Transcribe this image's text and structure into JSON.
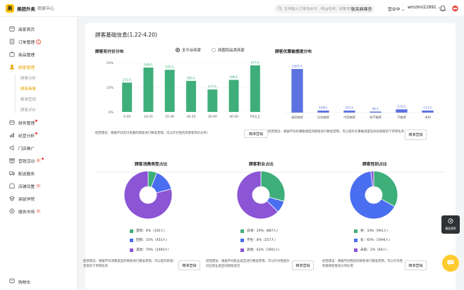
{
  "app": {
    "logo_char": "美",
    "name": "美团外卖",
    "center": "商家中心"
  },
  "search": {
    "placeholder": "支持输入订单流水号、商品名称、顾客地址"
  },
  "shop": {
    "name": "张亮麻辣烫",
    "status": "营业中",
    "account": "wmzlml21891"
  },
  "sidebar": {
    "items": [
      {
        "label": "商家首页",
        "icon": "home-icon"
      },
      {
        "label": "订单管理",
        "icon": "order-icon",
        "badge_count": "1"
      },
      {
        "label": "商品管理",
        "icon": "goods-icon"
      },
      {
        "label": "顾客管理",
        "icon": "customer-icon",
        "active": true
      },
      {
        "label": "财务管理",
        "icon": "finance-icon",
        "dot": true
      },
      {
        "label": "经营分析",
        "icon": "analysis-icon",
        "dot": true
      },
      {
        "label": "门店推广",
        "icon": "promo-icon"
      },
      {
        "label": "营销活动",
        "icon": "activity-icon",
        "badge": "新",
        "dot": true
      },
      {
        "label": "配送服务",
        "icon": "delivery-icon"
      },
      {
        "label": "店铺设置",
        "icon": "shop-settings-icon",
        "badge": "新"
      },
      {
        "label": "袋鼠学院",
        "icon": "school-icon"
      },
      {
        "label": "服务市场",
        "icon": "market-icon",
        "badge": "新"
      }
    ],
    "sub_items": [
      {
        "label": "顾客分析"
      },
      {
        "label": "顾客画像",
        "current": true
      },
      {
        "label": "精准营销"
      },
      {
        "label": "顾客评价"
      }
    ],
    "feedback": "购物车"
  },
  "main": {
    "title": "顾客基础信息(1.22-4.20)",
    "price_section": {
      "title": "顾客实付价分布",
      "options": [
        {
          "label": "全平台商家",
          "selected": true
        },
        {
          "label": "商圈同品类商家",
          "selected": false
        }
      ],
      "tip": "经营建议：根据不同实付金额的顾客进行精准营销，可以针对性的改善客单价分布！",
      "button": "精准营销"
    },
    "sensitivity_section": {
      "title": "顾客优惠敏感度分布",
      "tip": "经营建议：根据不同优惠敏感度的顾客进行精准营销，可以提升优惠敏感度较高的顾客的下单转化率",
      "button": "精准营销"
    },
    "pies": [
      {
        "title": "顾客消费类型占比",
        "legend": [
          "首购：6%（192人）",
          "回购：15%（453人）",
          "其他：79%（2400人）"
        ],
        "tip": "经营建议：根据不同消费类型的顾客进行精准营销，可以提升新客/老客的下单转化率",
        "button": "精准营销"
      },
      {
        "title": "顾客职业占比",
        "legend": [
          "白领：29%（887人）",
          "学生：8%（257人）",
          "其他：62%（1901人）"
        ],
        "tip": "经营建议：根据不同职业类型进行精准营销，可以针对性提升对应职业类型的顾客进店",
        "button": "精准营销"
      },
      {
        "title": "顾客性别占比",
        "legend": [
          "男：33%（991人）",
          "女：65%（1994人）",
          "未知：2%（60人）"
        ],
        "tip": "经营建议：根据不同性别的顾客进行精准营销，可以针对性改善顾客性别分布比例",
        "button": "精准营销"
      }
    ]
  },
  "float_tool": {
    "label": "精准营销"
  },
  "colors": {
    "green": "#3eae7a",
    "blue": "#4a6ef0",
    "purple": "#8b55d6",
    "accent": "#ffc300",
    "sensitivity_bar": "#5b72e0"
  },
  "chart_data": [
    {
      "type": "bar",
      "title": "顾客实付价分布",
      "categories": [
        "0-20",
        "20-25",
        "25-30",
        "30-35",
        "35-40",
        "40-50",
        "50以上"
      ],
      "values": [
        11.9,
        18.0,
        17.1,
        12.6,
        9.1,
        13.0,
        18.9
      ],
      "data_labels": [
        "372人",
        "548人",
        "522人",
        "385人",
        "277人",
        "396人",
        "577人"
      ],
      "yticks": [
        "0%",
        "10%",
        "20%"
      ],
      "ylim": [
        0,
        20
      ],
      "color": "#3eae7a"
    },
    {
      "type": "bar",
      "title": "顾客优惠敏感度分布",
      "categories": [
        "极度敏感",
        "比较敏感",
        "中度敏感",
        "较不敏感",
        "不敏感",
        "未知"
      ],
      "values": [
        2301,
        108,
        107,
        46,
        172,
        111
      ],
      "data_labels": [
        "2301人",
        "108人",
        "107人",
        "46人",
        "172人",
        "111人"
      ],
      "color": "#5b72e0"
    },
    {
      "type": "pie",
      "title": "顾客消费类型占比",
      "labels": [
        "首购",
        "回购",
        "其他"
      ],
      "values": [
        6,
        15,
        79
      ],
      "colors": [
        "#3eae7a",
        "#4a6ef0",
        "#8b55d6"
      ]
    },
    {
      "type": "pie",
      "title": "顾客职业占比",
      "labels": [
        "白领",
        "学生",
        "其他"
      ],
      "values": [
        29,
        8,
        62
      ],
      "colors": [
        "#3eae7a",
        "#4a6ef0",
        "#8b55d6"
      ]
    },
    {
      "type": "pie",
      "title": "顾客性别占比",
      "labels": [
        "男",
        "女",
        "未知"
      ],
      "values": [
        33,
        65,
        2
      ],
      "colors": [
        "#3eae7a",
        "#4a6ef0",
        "#8b55d6"
      ]
    }
  ]
}
